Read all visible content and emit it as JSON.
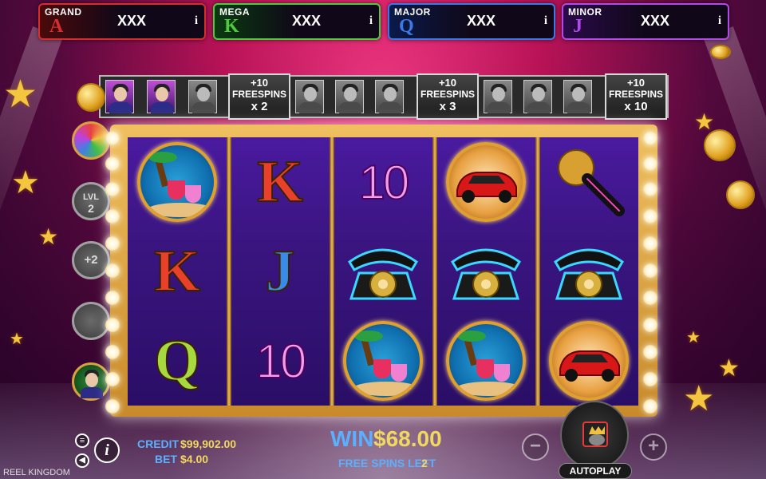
{
  "jackpots": [
    {
      "name": "GRAND",
      "letter": "A",
      "value": "XXX",
      "info": "i",
      "color": "#d62d2d",
      "bg": "#4a0a0a"
    },
    {
      "name": "MEGA",
      "letter": "K",
      "value": "XXX",
      "info": "i",
      "color": "#4ecb3a",
      "bg": "#0a3a10"
    },
    {
      "name": "MAJOR",
      "letter": "Q",
      "value": "XXX",
      "info": "i",
      "color": "#3a7ae8",
      "bg": "#0a1a4a"
    },
    {
      "name": "MINOR",
      "letter": "J",
      "value": "XXX",
      "info": "i",
      "color": "#b04ae8",
      "bg": "#2a0a4a"
    }
  ],
  "free_spins_track": {
    "prizes": [
      {
        "line1": "+10",
        "line2": "FREESPINS",
        "line3": "x 2"
      },
      {
        "line1": "+10",
        "line2": "FREESPINS",
        "line3": "x 3"
      },
      {
        "line1": "+10",
        "line2": "FREESPINS",
        "line3": "x 10"
      }
    ],
    "portraits_collected": 2,
    "portraits_total": 12
  },
  "side_features": {
    "level_label": "LVL",
    "level_value": "2",
    "plus_label": "+2"
  },
  "reels": [
    [
      "cocktail-coin",
      "K",
      "Q"
    ],
    [
      "K",
      "J",
      "10"
    ],
    [
      "10",
      "telephone",
      "cocktail-coin"
    ],
    [
      "car-coin",
      "telephone",
      "cocktail-coin"
    ],
    [
      "microphone",
      "telephone",
      "car-coin"
    ]
  ],
  "hud": {
    "credit_label": "CREDIT",
    "credit_value": "$99,902.00",
    "bet_label": "BET",
    "bet_value": "$4.00",
    "win_label": "WIN",
    "win_value": "$68.00",
    "free_spins_left_label": "FREE SPINS LEFT",
    "free_spins_left_value": "2",
    "autoplay_label": "AUTOPLAY",
    "info_label": "i",
    "minus_label": "−",
    "plus_label": "+",
    "brand": "REEL KINGDOM"
  },
  "colors": {
    "letter_K": "#e8402a",
    "letter_J": "#3a8ae8",
    "letter_Q": "#a8d840",
    "gold": "#f0c060",
    "hud_blue": "#5ab0ff"
  }
}
